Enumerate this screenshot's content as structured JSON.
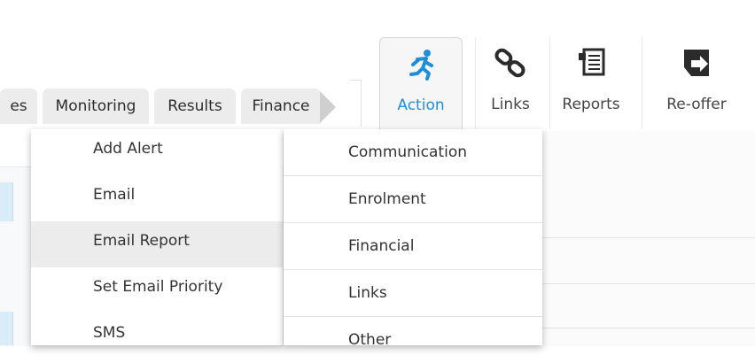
{
  "module_tabs": {
    "items": [
      {
        "label": "es"
      },
      {
        "label": "Monitoring"
      },
      {
        "label": "Results"
      },
      {
        "label": "Finance"
      }
    ],
    "scroll_arrow_icon": "triangle-right-icon"
  },
  "toolbar": {
    "buttons": [
      {
        "label": "Action",
        "icon": "running-person-icon",
        "active": true
      },
      {
        "label": "Links",
        "icon": "chain-link-icon",
        "active": false
      },
      {
        "label": "Reports",
        "icon": "report-document-icon",
        "active": false
      },
      {
        "label": "Re-offer",
        "icon": "reoffer-arrow-icon",
        "active": false
      }
    ],
    "accent_color": "#1f8ed8"
  },
  "action_menu": {
    "items": [
      {
        "label": "Add Alert"
      },
      {
        "label": "Email"
      },
      {
        "label": "Email Report",
        "highlighted": true
      },
      {
        "label": "Set Email Priority"
      },
      {
        "label": "SMS"
      }
    ]
  },
  "category_menu": {
    "items": [
      {
        "label": "Communication"
      },
      {
        "label": "Enrolment"
      },
      {
        "label": "Financial"
      },
      {
        "label": "Links"
      },
      {
        "label": "Other"
      }
    ]
  }
}
